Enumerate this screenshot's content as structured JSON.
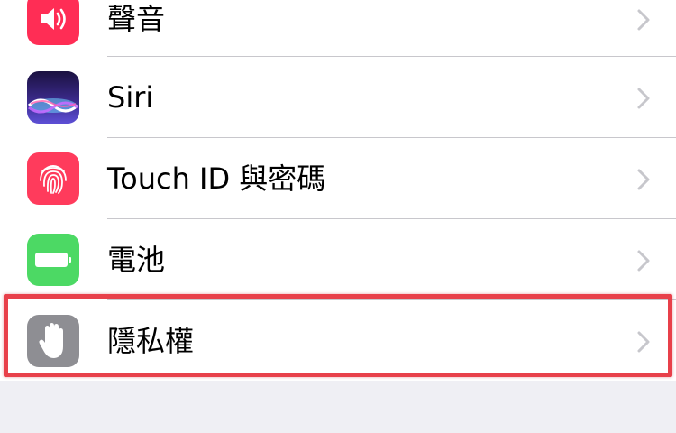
{
  "settings": {
    "items": [
      {
        "label": "聲音",
        "icon": "speaker-icon",
        "icon_color": "#ff2d55"
      },
      {
        "label": "Siri",
        "icon": "siri-icon",
        "icon_color": "#2b2a6b"
      },
      {
        "label": "Touch ID 與密碼",
        "icon": "fingerprint-icon",
        "icon_color": "#ff3b5c"
      },
      {
        "label": "電池",
        "icon": "battery-icon",
        "icon_color": "#4cd964"
      },
      {
        "label": "隱私權",
        "icon": "hand-icon",
        "icon_color": "#8e8e93"
      }
    ],
    "highlighted_item": "隱私權",
    "highlight_color": "#e8404a"
  }
}
